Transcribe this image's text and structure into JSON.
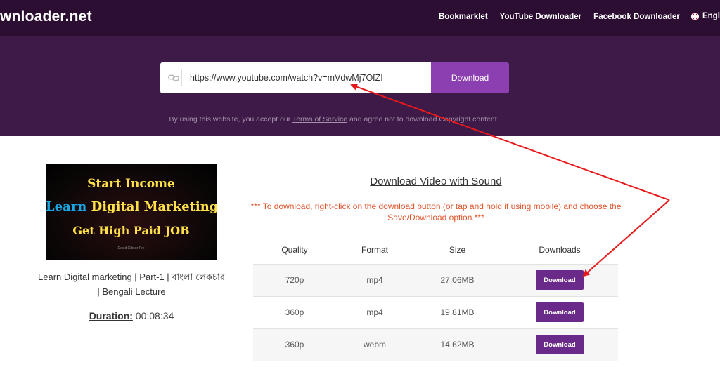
{
  "header": {
    "logo": "wnloader.net",
    "nav": [
      "Bookmarklet",
      "YouTube Downloader",
      "Facebook Downloader"
    ],
    "language": "Engl"
  },
  "search": {
    "url_value": "https://www.youtube.com/watch?v=mVdwMj7OfZI",
    "button_label": "Download",
    "tos_prefix": "By using this website, you accept our ",
    "tos_link": "Terms of Service",
    "tos_suffix": " and agree not to download Copyright content."
  },
  "video": {
    "thumb_line1": "Start Income",
    "thumb_line2_a": "Learn",
    "thumb_line2_b": " Digital Marketing",
    "thumb_line3": "Get High Paid JOB",
    "thumb_small": "David Gibsor Pro",
    "title": "Learn Digital marketing | Part-1 | বাংলা লেকচার | Bengali Lecture",
    "duration_label": "Duration:",
    "duration_value": " 00:08:34"
  },
  "downloads": {
    "section_title": "Download Video with Sound",
    "note": "*** To download, right-click on the download button (or tap and hold if using mobile) and choose the Save/Download option.***",
    "headers": [
      "Quality",
      "Format",
      "Size",
      "Downloads"
    ],
    "rows": [
      {
        "quality": "720p",
        "format": "mp4",
        "size": "27.06MB",
        "button": "Download"
      },
      {
        "quality": "360p",
        "format": "mp4",
        "size": "19.81MB",
        "button": "Download"
      },
      {
        "quality": "360p",
        "format": "webm",
        "size": "14.62MB",
        "button": "Download"
      }
    ]
  },
  "colors": {
    "header_bg": "#2c0e33",
    "hero_bg": "#3d1a47",
    "accent": "#8b3fb0",
    "row_button": "#6a2a8a",
    "note_text": "#e2552c",
    "annotation_arrow": "#e8191b"
  }
}
